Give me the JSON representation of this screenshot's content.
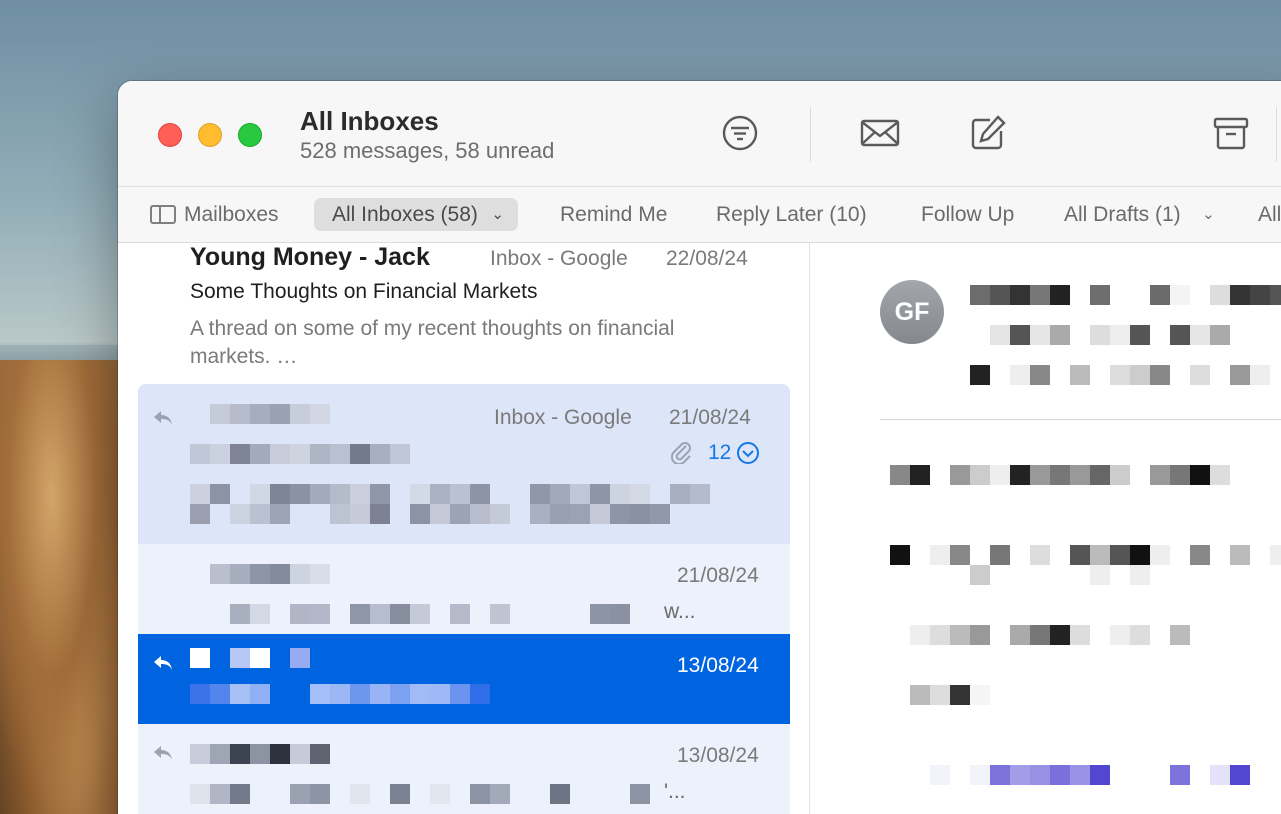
{
  "window": {
    "title": "All Inboxes",
    "subtitle": "528 messages, 58 unread"
  },
  "toolbar": {
    "icons": [
      "filter-icon",
      "envelope-icon",
      "compose-icon",
      "archive-icon"
    ]
  },
  "favorites": {
    "mailboxes": "Mailboxes",
    "all_inboxes": "All Inboxes (58)",
    "remind_me": "Remind Me",
    "reply_later": "Reply Later (10)",
    "follow_up": "Follow Up",
    "all_drafts": "All Drafts (1)",
    "overflow": "All"
  },
  "messages": [
    {
      "sender": "Young Money - Jack",
      "mailbox": "Inbox - Google",
      "date": "22/08/24",
      "subject": "Some Thoughts on Financial Markets",
      "preview": "A thread on some of my recent thoughts on financial markets. …"
    },
    {
      "mailbox": "Inbox - Google",
      "date": "21/08/24",
      "thread_count": "12"
    },
    {
      "date": "21/08/24",
      "preview_tail": "w..."
    },
    {
      "date": "13/08/24"
    },
    {
      "date": "13/08/24",
      "preview_tail": "'..."
    }
  ],
  "reader": {
    "avatar_initials": "GF"
  },
  "colors": {
    "selection": "#0064e1",
    "thread_highlight": "#dce6f8",
    "accent": "#1677e6"
  }
}
